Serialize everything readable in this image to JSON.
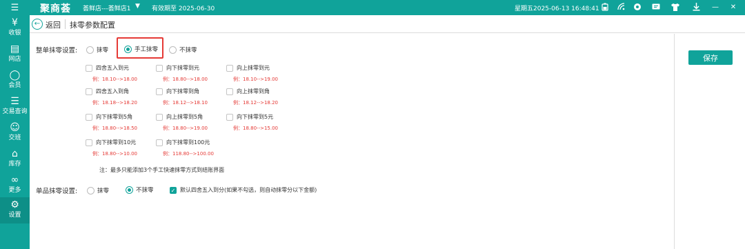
{
  "topbar": {
    "menu_icon": "hamburger-icon",
    "logo": "聚商荟",
    "store": "荟鲜店---荟鲜店1",
    "validity": "有效期至 2025-06-30",
    "datetime": "星期五2025-06-13 16:48:41",
    "icons": [
      "battery-icon",
      "wifi-icon",
      "service-icon",
      "message-icon",
      "shirt-icon",
      "download-icon",
      "minimize-icon",
      "close-icon"
    ]
  },
  "sidebar": {
    "items": [
      {
        "label": "收银",
        "icon": "cashier-icon"
      },
      {
        "label": "网店",
        "icon": "shop-icon"
      },
      {
        "label": "会员",
        "icon": "member-icon"
      },
      {
        "label": "交易查询",
        "icon": "document-icon"
      },
      {
        "label": "交班",
        "icon": "handover-icon"
      },
      {
        "label": "库存",
        "icon": "home-icon"
      },
      {
        "label": "更多",
        "icon": "more-icon"
      },
      {
        "label": "设置",
        "icon": "gear-icon"
      }
    ],
    "active_index": 7
  },
  "header": {
    "back_label": "返回",
    "title": "抹零参数配置"
  },
  "whole_order": {
    "label": "整单抹零设置:",
    "radios": [
      {
        "label": "抹零",
        "selected": false
      },
      {
        "label": "手工抹零",
        "selected": true
      },
      {
        "label": "不抹零",
        "selected": false
      }
    ],
    "options": [
      {
        "label": "四舍五入到元",
        "example": "例：18.10-->18.00"
      },
      {
        "label": "向下抹零到元",
        "example": "例：18.80-->18.00"
      },
      {
        "label": "向上抹零到元",
        "example": "例：18.10-->19.00"
      },
      {
        "label": "四舍五入到角",
        "example": "例：18.18-->18.20"
      },
      {
        "label": "向下抹零到角",
        "example": "例：18.12-->18.10"
      },
      {
        "label": "向上抹零到角",
        "example": "例：18.12-->18.20"
      },
      {
        "label": "向下抹零到5角",
        "example": "例：18.80-->18.50"
      },
      {
        "label": "向上抹零到5角",
        "example": "例：18.80-->19.00"
      },
      {
        "label": "向下抹零到5元",
        "example": "例：18.80-->15.00"
      },
      {
        "label": "向下抹零到10元",
        "example": "例：18.80-->10.00"
      },
      {
        "label": "向下抹零到100元",
        "example": "例：118.80-->100.00"
      }
    ],
    "note": "注：最多只能添加3个手工快速抹零方式到结账界面"
  },
  "single_item": {
    "label": "单品抹零设置:",
    "radios": [
      {
        "label": "抹零",
        "selected": false
      },
      {
        "label": "不抹零",
        "selected": true
      }
    ],
    "checkbox_label": "默认四舍五入到分(如果不勾选，则自动抹零分以下金额)",
    "checkbox_checked": true
  },
  "save_label": "保存",
  "colors": {
    "accent": "#10a39a",
    "highlight": "#e53935",
    "example_text": "#e53935"
  }
}
